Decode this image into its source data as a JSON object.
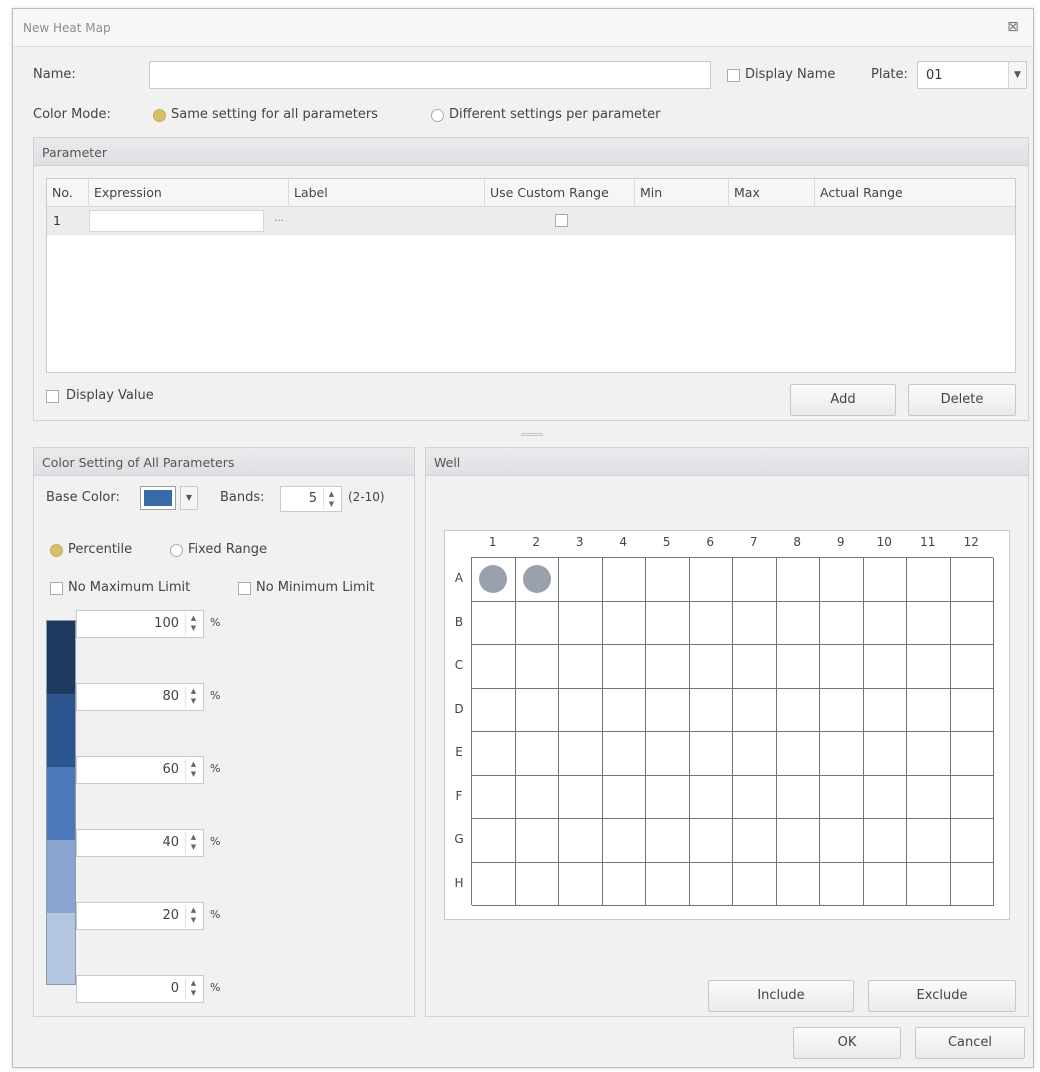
{
  "window": {
    "title": "New Heat Map",
    "close_glyph": "⊠"
  },
  "name_row": {
    "name_label": "Name:",
    "name_value": "",
    "display_name_label": "Display Name",
    "display_name_checked": false,
    "plate_label": "Plate:",
    "plate_value": "01"
  },
  "color_mode": {
    "label": "Color Mode:",
    "options": [
      "Same setting for all parameters",
      "Different settings per parameter"
    ],
    "selected": "Same setting for all parameters"
  },
  "parameter_group": {
    "title": "Parameter",
    "columns": [
      "No.",
      "Expression",
      "Label",
      "Use Custom Range",
      "Min",
      "Max",
      "Actual Range"
    ],
    "rows": [
      {
        "no": "1",
        "expression": "",
        "label": "",
        "use_custom_range": false,
        "min": "",
        "max": "",
        "actual_range": ""
      }
    ],
    "ellipsis": "...",
    "display_value_label": "Display Value",
    "display_value_checked": false,
    "add_label": "Add",
    "delete_label": "Delete"
  },
  "color_setting": {
    "title": "Color Setting of All Parameters",
    "base_color_label": "Base Color:",
    "base_color": "#3b6aa8",
    "bands_label": "Bands:",
    "bands_value": "5",
    "bands_range": "(2-10)",
    "range_modes": [
      "Percentile",
      "Fixed Range"
    ],
    "selected_range_mode": "Percentile",
    "no_max_label": "No Maximum Limit",
    "no_min_label": "No Minimum Limit",
    "thresholds": [
      "100",
      "80",
      "60",
      "40",
      "20",
      "0"
    ],
    "percent_sign": "%",
    "band_colors": [
      "#1f3a5f",
      "#2c5590",
      "#4a78b8",
      "#8aa5cf",
      "#b4c6e2"
    ]
  },
  "well": {
    "title": "Well",
    "columns": [
      "1",
      "2",
      "3",
      "4",
      "5",
      "6",
      "7",
      "8",
      "9",
      "10",
      "11",
      "12"
    ],
    "rows": [
      "A",
      "B",
      "C",
      "D",
      "E",
      "F",
      "G",
      "H"
    ],
    "selected_wells": [
      "A1",
      "A2"
    ],
    "include_label": "Include",
    "exclude_label": "Exclude"
  },
  "footer": {
    "ok_label": "OK",
    "cancel_label": "Cancel"
  }
}
